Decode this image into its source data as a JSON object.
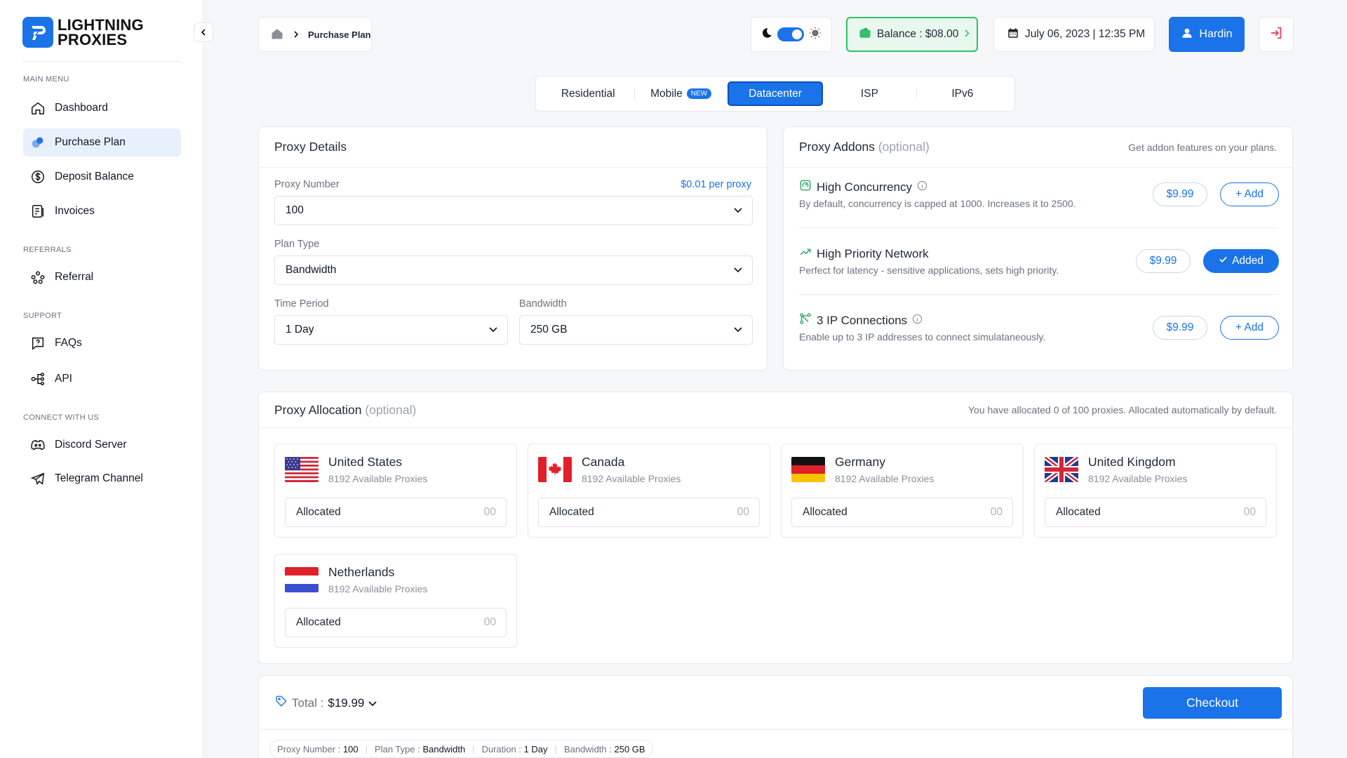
{
  "brand": {
    "line1": "LIGHTNING",
    "line2": "PROXIES"
  },
  "sidebar": {
    "sections": {
      "main": "MAIN MENU",
      "referrals": "REFERRALS",
      "support": "SUPPORT",
      "connect": "CONNECT WITH US"
    },
    "items": {
      "dashboard": "Dashboard",
      "purchase": "Purchase Plan",
      "deposit": "Deposit Balance",
      "invoices": "Invoices",
      "referral": "Referral",
      "faqs": "FAQs",
      "api": "API",
      "discord": "Discord Server",
      "telegram": "Telegram Channel"
    }
  },
  "header": {
    "breadcrumb": "Purchase Plan",
    "balance": "Balance : $08.00",
    "datetime": "July 06, 2023 | 12:35 PM",
    "user": "Hardin"
  },
  "tabs": {
    "residential": "Residential",
    "mobile": "Mobile",
    "mobile_badge": "NEW",
    "datacenter": "Datacenter",
    "isp": "ISP",
    "ipv6": "IPv6"
  },
  "proxy_details": {
    "title": "Proxy Details",
    "proxy_number_label": "Proxy Number",
    "price_per": "$0.01 per proxy",
    "proxy_number": "100",
    "plan_type_label": "Plan Type",
    "plan_type": "Bandwidth",
    "time_period_label": "Time Period",
    "time_period": "1 Day",
    "bandwidth_label": "Bandwidth",
    "bandwidth": "250 GB"
  },
  "addons": {
    "title": "Proxy Addons",
    "optional": "(optional)",
    "subtitle": "Get addon features on your plans.",
    "items": [
      {
        "name": "High Concurrency",
        "desc": "By default, concurrency is capped at 1000. Increases it to 2500.",
        "price": "$9.99",
        "action": "+ Add"
      },
      {
        "name": "High Priority Network",
        "desc": "Perfect for latency - sensitive applications, sets high priority.",
        "price": "$9.99",
        "action": "Added"
      },
      {
        "name": "3 IP Connections",
        "desc": "Enable up to 3 IP addresses to connect simulataneously.",
        "price": "$9.99",
        "action": "+ Add"
      }
    ]
  },
  "allocation": {
    "title": "Proxy Allocation",
    "optional": "(optional)",
    "subtitle": "You have allocated 0 of 100 proxies. Allocated automatically by default.",
    "countries": [
      {
        "name": "United States",
        "avail": "8192 Available Proxies",
        "label": "Allocated",
        "value": "00"
      },
      {
        "name": "Canada",
        "avail": "8192 Available Proxies",
        "label": "Allocated",
        "value": "00"
      },
      {
        "name": "Germany",
        "avail": "8192 Available Proxies",
        "label": "Allocated",
        "value": "00"
      },
      {
        "name": "United Kingdom",
        "avail": "8192 Available Proxies",
        "label": "Allocated",
        "value": "00"
      },
      {
        "name": "Netherlands",
        "avail": "8192 Available Proxies",
        "label": "Allocated",
        "value": "00"
      }
    ]
  },
  "footer": {
    "total_label": "Total :",
    "total_value": "$19.99",
    "checkout": "Checkout",
    "summary": {
      "proxy_number_label": "Proxy Number :",
      "proxy_number": "100",
      "plan_type_label": "Plan Type :",
      "plan_type": "Bandwidth",
      "duration_label": "Duration :",
      "duration": "1 Day",
      "bandwidth_label": "Bandwidth :",
      "bandwidth": "250 GB"
    }
  },
  "colors": {
    "accent": "#1a73e8",
    "success": "#34c06a",
    "danger": "#e53950"
  }
}
